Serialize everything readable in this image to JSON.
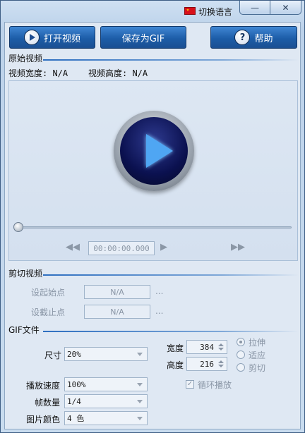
{
  "titlebar": {
    "language_button": "切换语言"
  },
  "toolbar": {
    "open_video": "打开视频",
    "save_gif": "保存为GIF",
    "help": "帮助",
    "help_glyph": "?"
  },
  "original_video": {
    "section_title": "原始视频",
    "width_text": "视频宽度: N/A",
    "height_text": "视频高度: N/A",
    "time": "00:00:00.000"
  },
  "cut_video": {
    "section_title": "剪切视频",
    "start_label": "设起始点",
    "start_value": "N/A",
    "end_label": "设截止点",
    "end_value": "N/A",
    "ellipsis": "..."
  },
  "gif": {
    "section_title": "GIF文件",
    "size_label": "尺寸",
    "size_value": "20%",
    "width_label": "宽度",
    "width_value": "384",
    "height_label": "高度",
    "height_value": "216",
    "mode_options": [
      "拉伸",
      "适应",
      "剪切"
    ],
    "speed_label": "播放速度",
    "speed_value": "100%",
    "frames_label": "帧数量",
    "frames_value": "1/4",
    "colors_label": "图片颜色",
    "colors_value": "4 色",
    "loop_label": "循环播放",
    "loop_checked": true
  },
  "colors": {
    "accent": "#1d5da8",
    "flag": "#d8101a"
  }
}
